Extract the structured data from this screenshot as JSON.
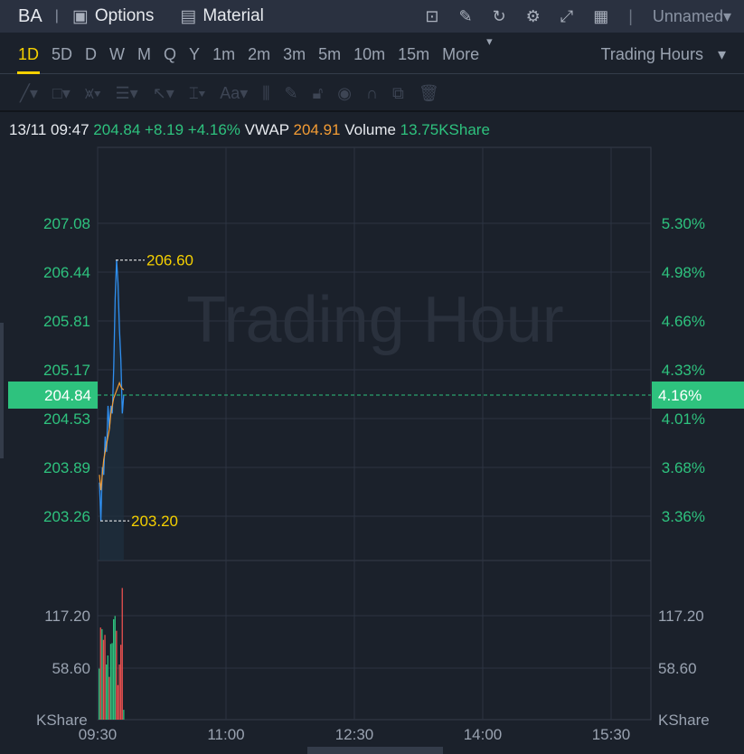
{
  "header": {
    "symbol": "BA",
    "options_label": "Options",
    "material_label": "Material",
    "layout_name": "Unnamed"
  },
  "periods": [
    "1D",
    "5D",
    "D",
    "W",
    "M",
    "Q",
    "Y",
    "1m",
    "2m",
    "3m",
    "5m",
    "10m",
    "15m",
    "More"
  ],
  "active_period": "1D",
  "session_select": "Trading Hours",
  "info": {
    "datetime": "13/11 09:47",
    "price": "204.84",
    "change": "+8.19",
    "change_pct": "+4.16%",
    "vwap_label": "VWAP",
    "vwap": "204.91",
    "volume_label": "Volume",
    "volume": "13.75KShare"
  },
  "watermark": "Trading Hour",
  "colors": {
    "up": "#2ec27e",
    "down": "#e8504f",
    "price_line": "#2f8ff0",
    "vwap_line": "#f39c34",
    "accent": "#f5d000"
  },
  "chart_data": {
    "type": "line",
    "price_ticks": [
      "207.08",
      "206.44",
      "205.81",
      "205.17",
      "204.53",
      "203.89",
      "203.26"
    ],
    "pct_ticks": [
      "5.30%",
      "4.98%",
      "4.66%",
      "4.33%",
      "4.01%",
      "3.68%",
      "3.36%"
    ],
    "price_range": [
      203.26,
      207.08
    ],
    "current_price": "204.84",
    "current_pct": "4.16%",
    "high_label": "206.60",
    "low_label": "203.20",
    "high": 206.6,
    "low": 203.2,
    "time_ticks": [
      "09:30",
      "11:00",
      "12:30",
      "14:00",
      "15:30"
    ],
    "price": [
      203.7,
      203.2,
      203.9,
      203.8,
      204.3,
      204.1,
      204.7,
      204.4,
      204.7,
      204.6,
      205.2,
      206.1,
      206.6,
      206.3,
      205.7,
      205.3,
      204.6,
      204.84
    ],
    "vwap": [
      203.8,
      203.6,
      203.8,
      204.0,
      204.1,
      204.2,
      204.3,
      204.4,
      204.6,
      204.7,
      204.8,
      204.85,
      204.9,
      204.95,
      205.0,
      204.95,
      204.92,
      204.91
    ],
    "volume_ticks": [
      "117.20",
      "58.60"
    ],
    "volume_unit": "KShare",
    "volume_max": 175.8,
    "volume": [
      62,
      112,
      110,
      97,
      103,
      67,
      78,
      52,
      92,
      93,
      122,
      126,
      108,
      42,
      67,
      91,
      160,
      12
    ],
    "volume_up": [
      true,
      false,
      true,
      false,
      false,
      true,
      true,
      false,
      true,
      true,
      true,
      true,
      false,
      false,
      false,
      false,
      false,
      true
    ]
  }
}
